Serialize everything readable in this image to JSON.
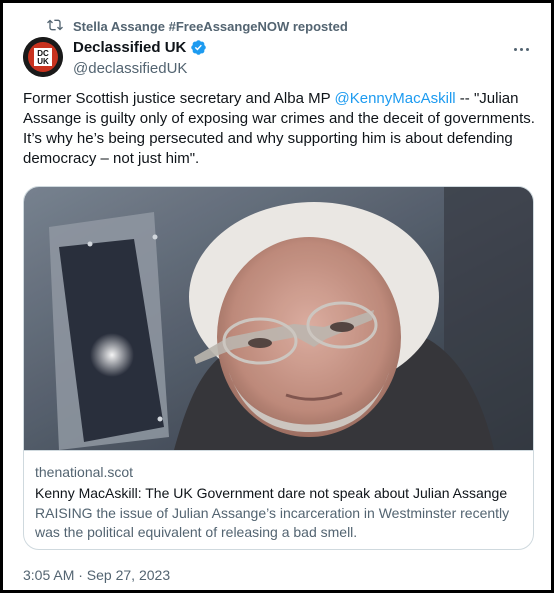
{
  "repost": {
    "icon": "repost-icon",
    "text": "Stella Assange #FreeAssangeNOW reposted"
  },
  "author": {
    "name": "Declassified UK",
    "handle": "@declassifiedUK",
    "avatar_text": "DCUK",
    "verified_color": "#1d9bf0"
  },
  "tweet": {
    "text_before": "Former Scottish justice secretary and Alba MP ",
    "mention": "@KennyMacAskill",
    "text_after": " -- \"Julian Assange is guilty only of exposing war crimes and the deceit of governments. It’s why he’s being persecuted and why supporting him is about defending democracy – not just him\"."
  },
  "card": {
    "domain": "thenational.scot",
    "title": "Kenny MacAskill: The UK Government dare not speak about Julian Assange",
    "description": "RAISING the issue of Julian Assange’s incarceration in Westminster recently was the political equivalent of releasing a bad smell."
  },
  "meta": {
    "timestamp": "3:05 AM · Sep 27, 2023"
  },
  "colors": {
    "accent": "#1d9bf0",
    "secondary_text": "#536471",
    "primary_text": "#0f1419",
    "border": "#cfd9de"
  }
}
